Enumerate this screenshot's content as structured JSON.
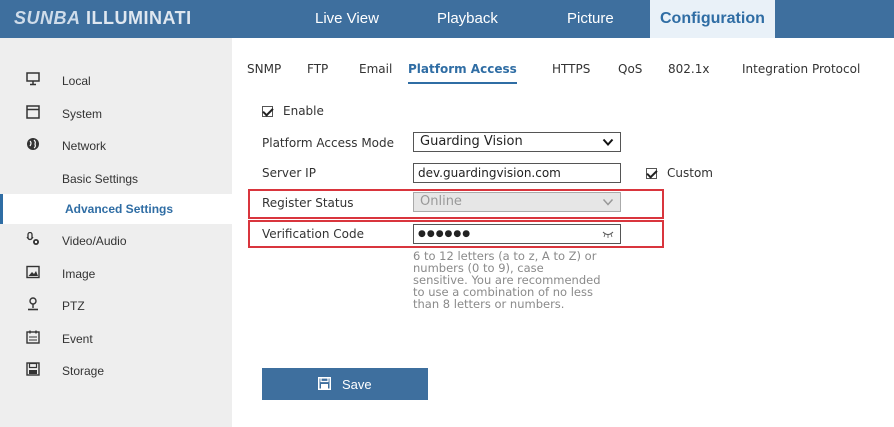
{
  "header": {
    "logo_part1": "SUNBA",
    "logo_part2": "ILLUMINATI",
    "nav": [
      "Live View",
      "Playback",
      "Picture",
      "Configuration"
    ],
    "active_nav": "Configuration"
  },
  "sidebar": {
    "items": [
      {
        "label": "Local",
        "icon": "monitor-icon"
      },
      {
        "label": "System",
        "icon": "window-icon"
      },
      {
        "label": "Network",
        "icon": "globe-icon"
      },
      {
        "label": "Basic Settings",
        "icon": ""
      },
      {
        "label": "Advanced Settings",
        "icon": "",
        "active": true
      },
      {
        "label": "Video/Audio",
        "icon": "mic-camera-icon"
      },
      {
        "label": "Image",
        "icon": "image-icon"
      },
      {
        "label": "PTZ",
        "icon": "ptz-icon"
      },
      {
        "label": "Event",
        "icon": "calendar-icon"
      },
      {
        "label": "Storage",
        "icon": "disk-icon"
      }
    ]
  },
  "tabs": {
    "items": [
      "SNMP",
      "FTP",
      "Email",
      "Platform Access",
      "HTTPS",
      "QoS",
      "802.1x",
      "Integration Protocol"
    ],
    "active": "Platform Access"
  },
  "form": {
    "enable_label": "Enable",
    "enable_checked": true,
    "mode_label": "Platform Access Mode",
    "mode_value": "Guarding Vision",
    "server_label": "Server IP",
    "server_value": "dev.guardingvision.com",
    "custom_label": "Custom",
    "custom_checked": true,
    "register_label": "Register Status",
    "register_value": "Online",
    "verification_label": "Verification Code",
    "verification_value": "●●●●●●",
    "hint_lines": [
      "6 to 12 letters (a to z, A to Z) or",
      "numbers (0 to 9), case",
      "sensitive. You are recommended",
      "to use a combination of no less",
      "than 8 letters or numbers."
    ],
    "save_label": "Save"
  },
  "colors": {
    "header_bg": "#3e6f9e",
    "accent": "#2f6da4",
    "highlight": "#d9353d"
  }
}
